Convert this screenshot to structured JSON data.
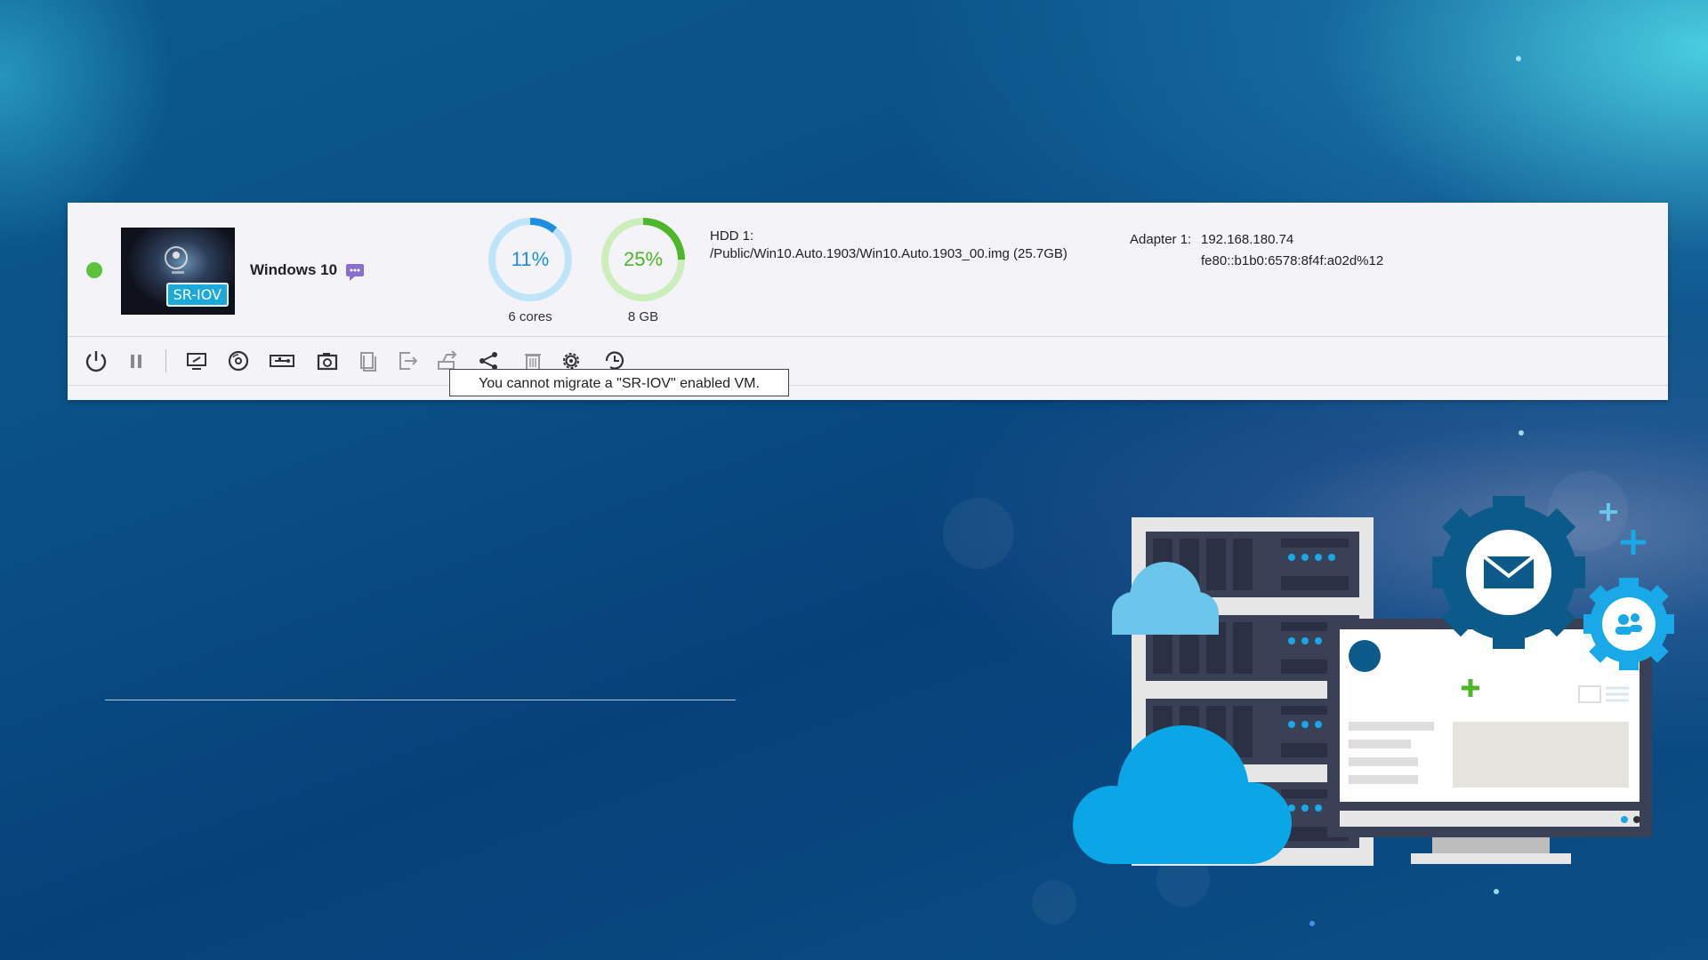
{
  "vm": {
    "status_color": "#5cc23c",
    "thumbnail_badge": "SR-IOV",
    "name": "Windows 10",
    "note_icon": "comment-icon",
    "cpu": {
      "percent": 11,
      "label": "11%",
      "caption": "6 cores",
      "color": "#1e8fe0",
      "track": "#bfe4f7"
    },
    "memory": {
      "percent": 25,
      "label": "25%",
      "caption": "8 GB",
      "color": "#4fb52b",
      "track": "#cdeebc"
    },
    "hdd": {
      "title": "HDD 1:",
      "path": "/Public/Win10.Auto.1903/Win10.Auto.1903_00.img (25.7GB)"
    },
    "adapter": {
      "label": "Adapter 1:",
      "ipv4": "192.168.180.74",
      "ipv6": "fe80::b1b0:6578:8f4f:a02d%12"
    }
  },
  "toolbar": {
    "buttons": [
      {
        "name": "power-button",
        "icon": "power-icon"
      },
      {
        "name": "pause-button",
        "icon": "pause-icon"
      },
      {
        "name": "console-button",
        "icon": "monitor-icon"
      },
      {
        "name": "cd-button",
        "icon": "disc-icon"
      },
      {
        "name": "usb-button",
        "icon": "usb-icon"
      },
      {
        "name": "snapshot-button",
        "icon": "camera-icon"
      },
      {
        "name": "clone-button",
        "icon": "copy-icon"
      },
      {
        "name": "export-button",
        "icon": "export-icon"
      },
      {
        "name": "migrate-button",
        "icon": "migrate-icon"
      },
      {
        "name": "share-button",
        "icon": "share-icon"
      },
      {
        "name": "delete-button",
        "icon": "trash-icon"
      },
      {
        "name": "settings-button",
        "icon": "gear-icon"
      },
      {
        "name": "schedule-button",
        "icon": "clock-icon"
      }
    ],
    "tooltip": "You cannot migrate a \"SR-IOV\" enabled VM."
  }
}
